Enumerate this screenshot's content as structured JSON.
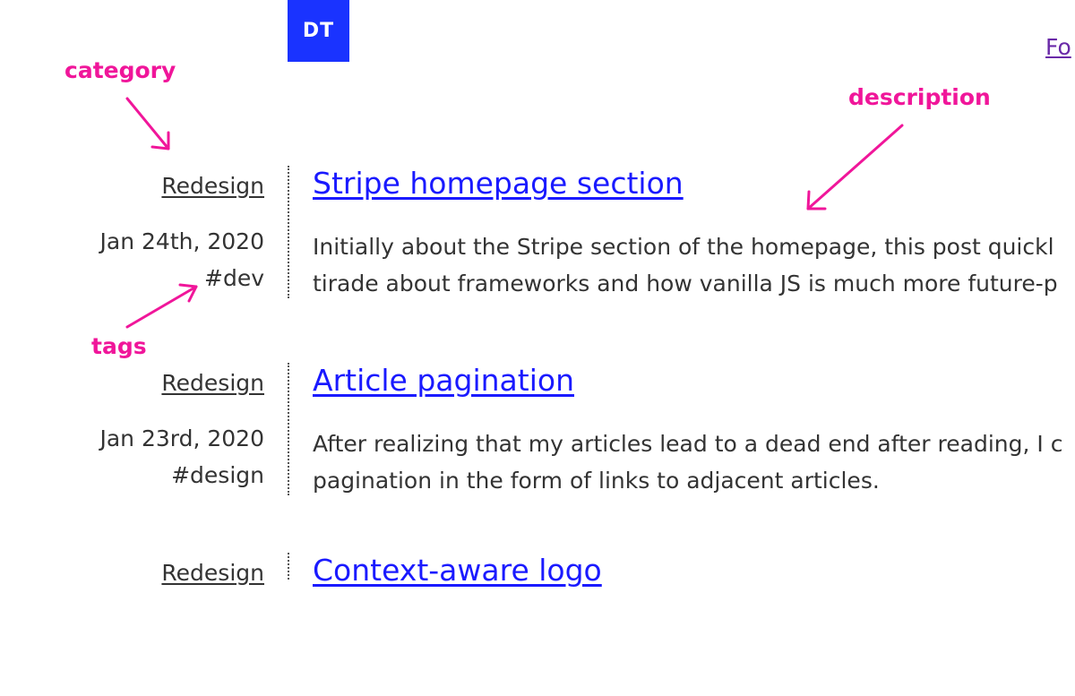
{
  "header": {
    "logo_text": "DT",
    "nav_link": "Fo"
  },
  "annotations": {
    "category": "category",
    "description": "description",
    "tags": "tags"
  },
  "entries": [
    {
      "category": "Redesign",
      "date": "Jan 24th, 2020",
      "tag": "#dev",
      "title": "Stripe homepage section",
      "desc_line1": "Initially about the Stripe section of the homepage, this post quickl",
      "desc_line2": "tirade about frameworks and how vanilla JS is much more future-p"
    },
    {
      "category": "Redesign",
      "date": "Jan 23rd, 2020",
      "tag": "#design",
      "title": "Article pagination",
      "desc_line1": "After realizing that my articles lead to a dead end after reading, I c",
      "desc_line2": "pagination in the form of links to adjacent articles."
    },
    {
      "category": "Redesign",
      "title": "Context-aware logo"
    }
  ],
  "colors": {
    "accent": "#1a33ff",
    "link": "#1a1aff",
    "annotation": "#f0169a",
    "visited": "#6a2aa8"
  }
}
